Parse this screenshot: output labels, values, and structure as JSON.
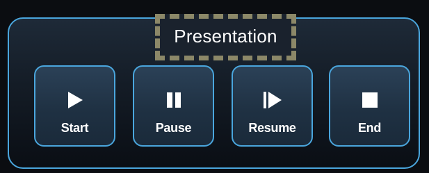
{
  "panel": {
    "title": "Presentation"
  },
  "buttons": {
    "start": {
      "label": "Start",
      "icon": "play-icon"
    },
    "pause": {
      "label": "Pause",
      "icon": "pause-icon"
    },
    "resume": {
      "label": "Resume",
      "icon": "resume-icon"
    },
    "end": {
      "label": "End",
      "icon": "stop-icon"
    }
  },
  "colors": {
    "accent_border": "#4aa6dd",
    "title_dashed_border": "#8c8868",
    "button_fill": "#2b4157",
    "text": "#ffffff"
  }
}
